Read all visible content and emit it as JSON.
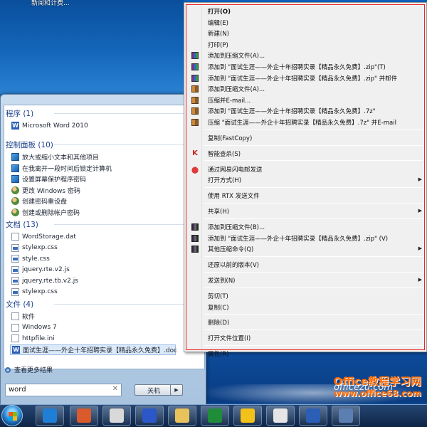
{
  "desktop": {
    "icon_label": "新闻和计费..."
  },
  "start_menu": {
    "groups": [
      {
        "header": "程序 (1)",
        "items": [
          {
            "label": "Microsoft Word 2010",
            "icon": "word-icon"
          }
        ]
      },
      {
        "header": "控制面板 (10)",
        "items": [
          {
            "label": "放大或缩小文本和其他项目",
            "icon": "control-panel-icon"
          },
          {
            "label": "在我离开一段时间后锁定计算机",
            "icon": "control-panel-icon"
          },
          {
            "label": "设置屏幕保护程序密码",
            "icon": "control-panel-icon"
          },
          {
            "label": "更改 Windows 密码",
            "icon": "user-accounts-icon"
          },
          {
            "label": "创建密码重设盘",
            "icon": "user-accounts-icon"
          },
          {
            "label": "创建或删除帐户密码",
            "icon": "user-accounts-icon"
          }
        ]
      },
      {
        "header": "文档 (13)",
        "items": [
          {
            "label": "WordStorage.dat",
            "icon": "file-icon"
          },
          {
            "label": "stylexp.css",
            "icon": "css-file-icon"
          },
          {
            "label": "style.css",
            "icon": "css-file-icon"
          },
          {
            "label": "jquery.rte.v2.js",
            "icon": "js-file-icon"
          },
          {
            "label": "jquery.rte.tb.v2.js",
            "icon": "js-file-icon"
          },
          {
            "label": "stylexp.css",
            "icon": "css-file-icon"
          }
        ]
      },
      {
        "header": "文件 (4)",
        "items": [
          {
            "label": "软件",
            "icon": "file-icon"
          },
          {
            "label": "Windows 7",
            "icon": "file-icon"
          },
          {
            "label": "httpfile.ini",
            "icon": "file-icon"
          },
          {
            "label": "面试生涯——外企十年招聘实录【精品永久免费】.doc",
            "icon": "word-doc-icon",
            "selected": true
          }
        ]
      }
    ],
    "more_results": "查看更多结果",
    "search_value": "word",
    "shutdown_label": "关机"
  },
  "context_menu": {
    "items": [
      {
        "label": "打开(O)",
        "bold": true
      },
      {
        "label": "编辑(E)"
      },
      {
        "label": "新建(N)"
      },
      {
        "label": "打印(P)"
      },
      {
        "label": "添加到压缩文件(A)...",
        "icon": "winrar-icon"
      },
      {
        "label": "添加到 \"面试生涯——外企十年招聘实录【精品永久免费】.zip\"(T)",
        "icon": "winrar-icon"
      },
      {
        "label": "添加到 \"面试生涯——外企十年招聘实录【精品永久免费】.zip\" 并邮件",
        "icon": "winrar-icon"
      },
      {
        "label": "添加到压缩文件(A)...",
        "icon": "7zip-icon"
      },
      {
        "label": "压缩并E-mail...",
        "icon": "7zip-icon"
      },
      {
        "label": "添加到 \"面试生涯——外企十年招聘实录【精品永久免费】.7z\"",
        "icon": "7zip-icon"
      },
      {
        "label": "压缩 \"面试生涯——外企十年招聘实录【精品永久免费】.7z\" 并E-mail",
        "icon": "7zip-icon"
      },
      {
        "label": "复制(FastCopy)",
        "sep_before": true
      },
      {
        "label": "智能查杀(S)",
        "icon": "antivirus-icon",
        "sep_before": true
      },
      {
        "label": "通过网易闪电邮发送",
        "icon": "mail-lock-icon",
        "sep_before": true
      },
      {
        "label": "打开方式(H)",
        "submenu": true
      },
      {
        "label": "使用 RTX 发送文件",
        "sep_before": true
      },
      {
        "label": "共享(H)",
        "submenu": true,
        "sep_before": true
      },
      {
        "label": "添加到压缩文件(B)...",
        "icon": "books-icon",
        "sep_before": true
      },
      {
        "label": "添加到 \"面试生涯——外企十年招聘实录【精品永久免费】.zip\" (V)",
        "icon": "books-icon"
      },
      {
        "label": "其他压缩命令(Q)",
        "icon": "books-icon",
        "submenu": true
      },
      {
        "label": "还原以前的版本(V)",
        "sep_before": true
      },
      {
        "label": "发送到(N)",
        "submenu": true,
        "sep_before": true
      },
      {
        "label": "剪切(T)",
        "sep_before": true
      },
      {
        "label": "复制(C)"
      },
      {
        "label": "删除(D)",
        "sep_before": true
      },
      {
        "label": "打开文件位置(I)",
        "sep_before": true
      },
      {
        "label": "属性(R)",
        "sep_before": true
      }
    ]
  },
  "watermark": {
    "site": "officezu.com",
    "main": "Office教程学习网",
    "sub": "www.office68.com"
  },
  "taskbar": {
    "buttons": [
      {
        "icon": "ie-icon",
        "color": "#1f7fd6"
      },
      {
        "icon": "paint-icon",
        "color": "#d95a2a"
      },
      {
        "icon": "pen-tool-icon",
        "color": "#d9d9d9"
      },
      {
        "icon": "media-player-icon",
        "color": "#2b57c9"
      },
      {
        "icon": "folder-icon",
        "color": "#e8c25a"
      },
      {
        "icon": "excel-icon",
        "color": "#1f8c3a"
      },
      {
        "icon": "qq-icon",
        "color": "#f2c21a"
      },
      {
        "icon": "mail-icon",
        "color": "#e5e5e5"
      },
      {
        "icon": "word-icon",
        "color": "#2b5fb5"
      },
      {
        "icon": "app-icon",
        "color": "#5a7fb0"
      }
    ]
  }
}
